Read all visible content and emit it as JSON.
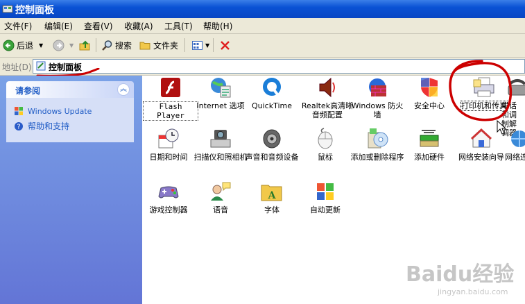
{
  "window": {
    "title": "控制面板"
  },
  "menu": [
    "文件(F)",
    "编辑(E)",
    "查看(V)",
    "收藏(A)",
    "工具(T)",
    "帮助(H)"
  ],
  "toolbar": {
    "back": "后退",
    "search": "搜索",
    "folders": "文件夹"
  },
  "address": {
    "label": "地址(D)",
    "value": "控制面板"
  },
  "sidebar": {
    "heading": "请参阅",
    "links": [
      "Windows Update",
      "帮助和支持"
    ]
  },
  "items": [
    {
      "label": "Flash Player",
      "icon": "flash-icon"
    },
    {
      "label": "Internet 选项",
      "icon": "internet-options-icon"
    },
    {
      "label": "QuickTime",
      "icon": "quicktime-icon"
    },
    {
      "label": "Realtek高清晰音频配置",
      "icon": "speaker-icon"
    },
    {
      "label": "Windows 防火墙",
      "icon": "firewall-icon"
    },
    {
      "label": "安全中心",
      "icon": "shield-icon"
    },
    {
      "label": "打印机和传真",
      "icon": "printer-icon"
    },
    {
      "label": "电话和调制解调器",
      "icon": "phone-icon"
    },
    {
      "label": "日期和时间",
      "icon": "clock-icon"
    },
    {
      "label": "扫描仪和照相机",
      "icon": "scanner-icon"
    },
    {
      "label": "声音和音频设备",
      "icon": "sound-icon"
    },
    {
      "label": "鼠标",
      "icon": "mouse-icon"
    },
    {
      "label": "添加或删除程序",
      "icon": "add-remove-icon"
    },
    {
      "label": "添加硬件",
      "icon": "hardware-icon"
    },
    {
      "label": "网络安装向导",
      "icon": "network-wizard-icon"
    },
    {
      "label": "网络连接",
      "icon": "network-icon"
    },
    {
      "label": "游戏控制器",
      "icon": "gamepad-icon"
    },
    {
      "label": "语音",
      "icon": "speech-icon"
    },
    {
      "label": "字体",
      "icon": "fonts-icon"
    },
    {
      "label": "自动更新",
      "icon": "windows-update-icon"
    }
  ],
  "watermark": {
    "brand": "Baidu经验",
    "url": "jingyan.baidu.com"
  },
  "colors": {
    "title_bar": "#0a52d4",
    "annotation": "#cc0000",
    "sidebar": "#7ba2e7"
  }
}
